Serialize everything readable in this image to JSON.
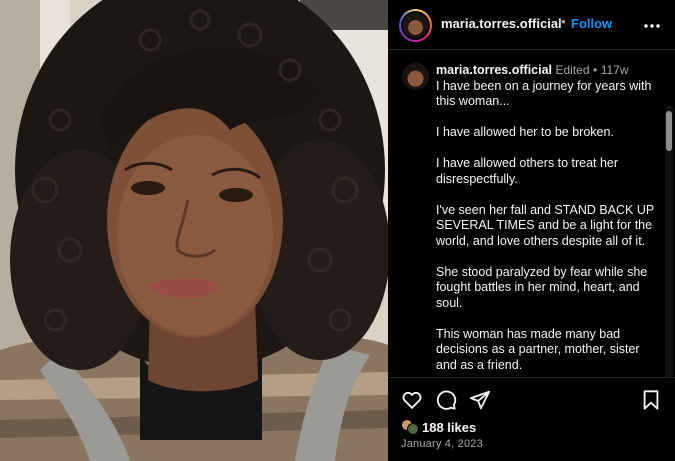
{
  "header": {
    "username": "maria.torres.official",
    "separator": "•",
    "follow_label": "Follow",
    "more_icon": "more-horizontal-icon"
  },
  "caption": {
    "username": "maria.torres.official",
    "edited": "Edited",
    "separator": "•",
    "age": "117w",
    "paragraphs": [
      "I have been on a journey for years with this woman...",
      "I have allowed her to be broken.",
      "I have allowed others to treat her disrespectfully.",
      "I've seen her fall and STAND BACK UP SEVERAL TIMES and be a light for the world, and love others despite all of it.",
      "She stood paralyzed by fear while she fought battles in her mind, heart, and soul.",
      "This woman has made many bad decisions as a partner, mother, sister and as a friend."
    ]
  },
  "actions": {
    "like_icon": "heart-icon",
    "comment_icon": "comment-icon",
    "share_icon": "share-icon",
    "save_icon": "bookmark-icon"
  },
  "likes": "188 likes",
  "date": "January 4, 2023",
  "colors": {
    "background": "#000000",
    "text": "#f5f5f5",
    "muted": "#a8a8a8",
    "follow": "#0095f6",
    "divider": "#262626"
  }
}
